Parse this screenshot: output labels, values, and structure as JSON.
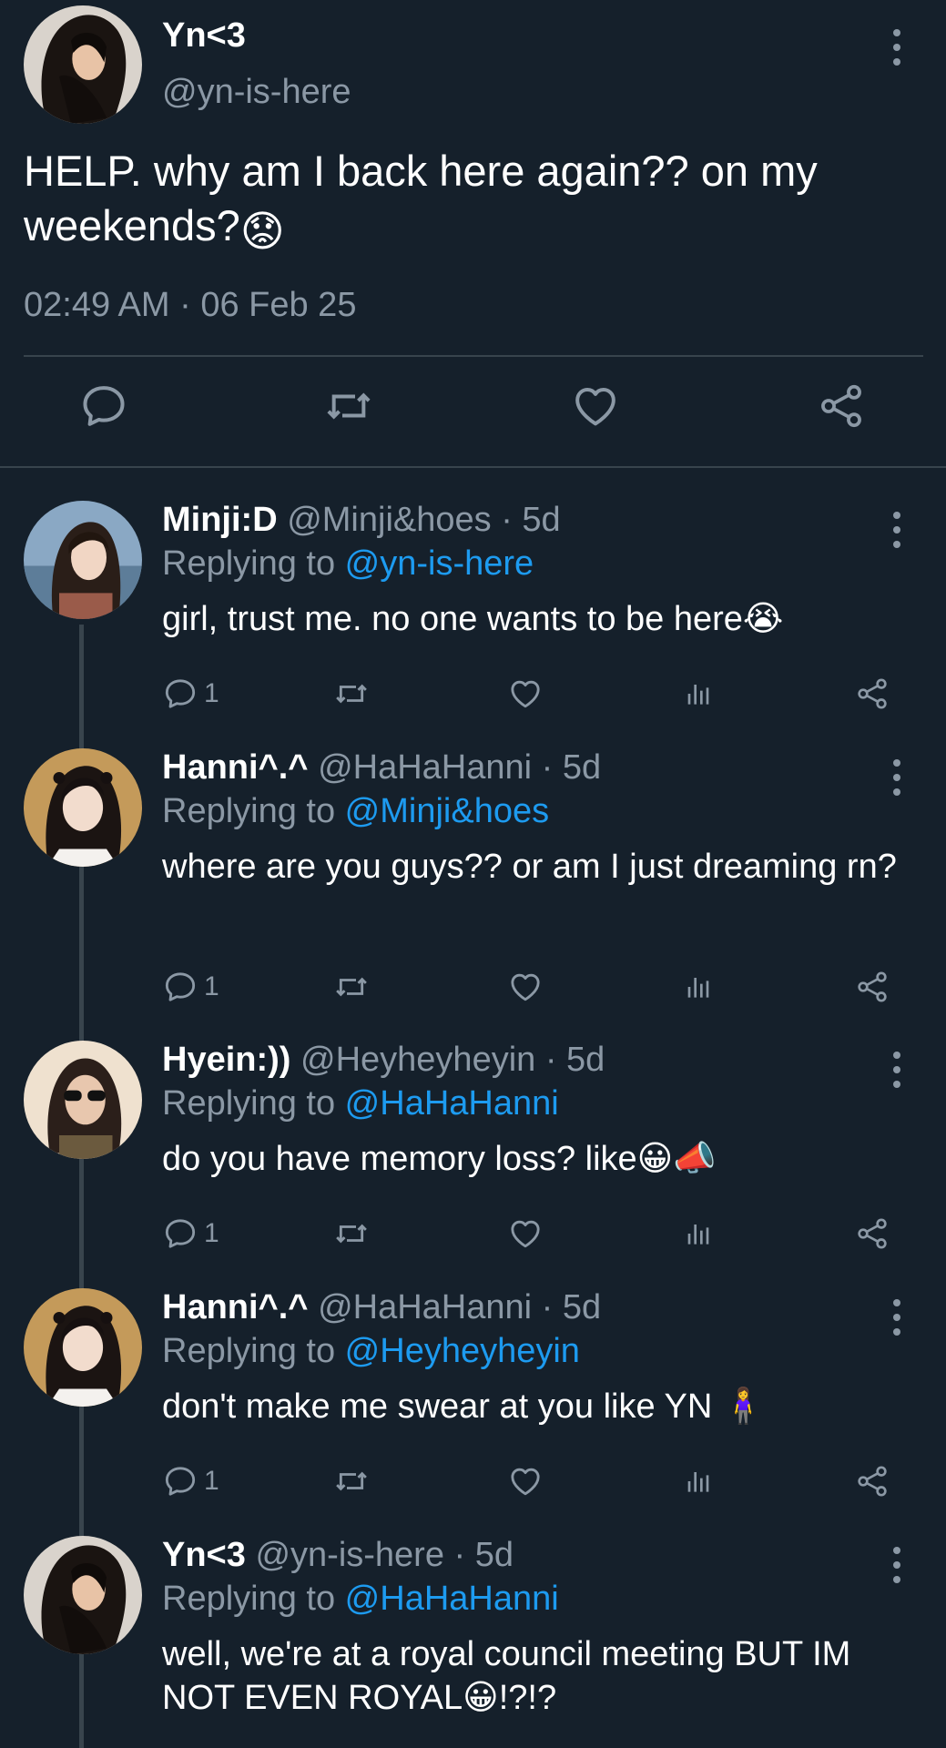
{
  "main_tweet": {
    "author_name": "Yn<3",
    "author_handle": "@yn-is-here",
    "text": "HELP. why am I back here again?? on my weekends?",
    "emoji": "😟",
    "timestamp": "02:49 AM · 06 Feb 25"
  },
  "replying_prefix": "Replying to ",
  "replies": [
    {
      "name": "Minji:D",
      "meta": "@Minji&hoes · 5d",
      "replying_to": "@yn-is-here",
      "text": "girl, trust me. no one wants to be here😭",
      "reply_count": "1"
    },
    {
      "name": "Hanni^.^",
      "meta": "@HaHaHanni · 5d",
      "replying_to": "@Minji&hoes",
      "text": "where are you guys?? or am I just dreaming rn?",
      "reply_count": "1"
    },
    {
      "name": "Hyein:))",
      "meta": "@Heyheyheyin · 5d",
      "replying_to": "@HaHaHanni",
      "text": "do you have memory loss? like😀📣",
      "reply_count": "1"
    },
    {
      "name": "Hanni^.^",
      "meta": "@HaHaHanni · 5d",
      "replying_to": "@Heyheyheyin",
      "text": "don't make me swear at you like YN 🧍‍♀️",
      "reply_count": "1"
    },
    {
      "name": "Yn<3",
      "meta": "@yn-is-here · 5d",
      "replying_to": "@HaHaHanni",
      "text": "well, we're at a royal council meeting BUT IM NOT EVEN ROYAL😀!?!?"
    }
  ],
  "icons": {
    "reply": "reply-icon",
    "retweet": "retweet-icon",
    "like": "heart-icon",
    "views": "views-icon",
    "share": "share-icon",
    "more": "more-options-icon"
  },
  "colors": {
    "background": "#15202b",
    "text": "#ffffff",
    "muted": "#8b98a5",
    "accent": "#1d9bf0",
    "divider": "#38444d"
  }
}
